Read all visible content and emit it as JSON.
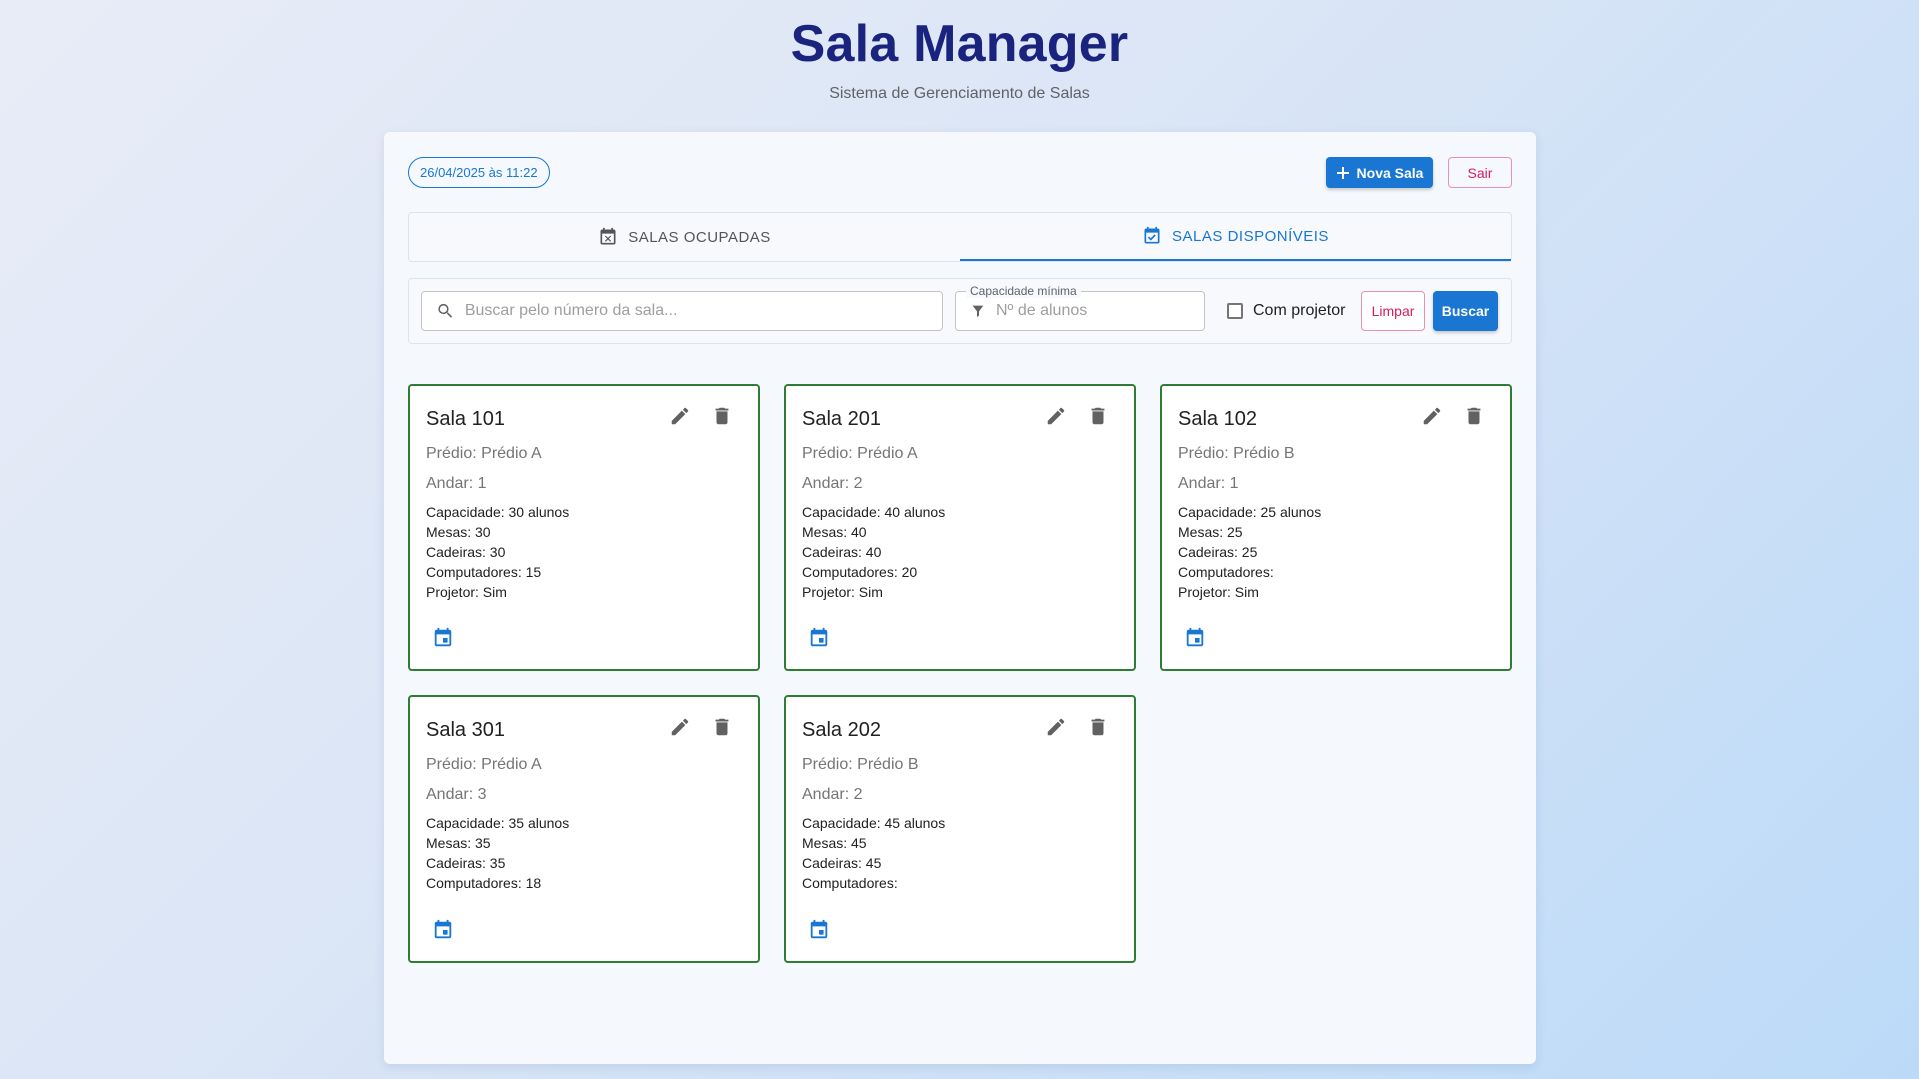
{
  "header": {
    "title": "Sala Manager",
    "subtitle": "Sistema de Gerenciamento de Salas"
  },
  "topbar": {
    "datetime": "26/04/2025 às 11:22",
    "new_room_label": "Nova Sala",
    "exit_label": "Sair"
  },
  "tabs": [
    {
      "label": "SALAS OCUPADAS",
      "icon": "calendar-x-icon",
      "active": false
    },
    {
      "label": "SALAS DISPONÍVEIS",
      "icon": "calendar-check-icon",
      "active": true
    }
  ],
  "filters": {
    "search_placeholder": "Buscar pelo número da sala...",
    "search_value": "",
    "capacity_label": "Capacidade mínima",
    "capacity_placeholder": "Nº de alunos",
    "projector_label": "Com projetor",
    "projector_checked": false,
    "clear_label": "Limpar",
    "search_label": "Buscar"
  },
  "rooms": [
    {
      "title": "Sala 101",
      "building": "Prédio: Prédio A",
      "floor": "Andar: 1",
      "capacity": "Capacidade: 30 alunos",
      "tables": "Mesas: 30",
      "chairs": "Cadeiras: 30",
      "computers": "Computadores: 15",
      "projector": "Projetor: Sim"
    },
    {
      "title": "Sala 201",
      "building": "Prédio: Prédio A",
      "floor": "Andar: 2",
      "capacity": "Capacidade: 40 alunos",
      "tables": "Mesas: 40",
      "chairs": "Cadeiras: 40",
      "computers": "Computadores: 20",
      "projector": "Projetor: Sim"
    },
    {
      "title": "Sala 102",
      "building": "Prédio: Prédio B",
      "floor": "Andar: 1",
      "capacity": "Capacidade: 25 alunos",
      "tables": "Mesas: 25",
      "chairs": "Cadeiras: 25",
      "computers": "Computadores:",
      "projector": "Projetor: Sim"
    },
    {
      "title": "Sala 301",
      "building": "Prédio: Prédio A",
      "floor": "Andar: 3",
      "capacity": "Capacidade: 35 alunos",
      "tables": "Mesas: 35",
      "chairs": "Cadeiras: 35",
      "computers": "Computadores: 18"
    },
    {
      "title": "Sala 202",
      "building": "Prédio: Prédio B",
      "floor": "Andar: 2",
      "capacity": "Capacidade: 45 alunos",
      "tables": "Mesas: 45",
      "chairs": "Cadeiras: 45",
      "computers": "Computadores:"
    }
  ],
  "colors": {
    "primary": "#1976d2",
    "title": "#1a237e",
    "card_border": "#2e7d32",
    "danger": "#d81b60"
  }
}
